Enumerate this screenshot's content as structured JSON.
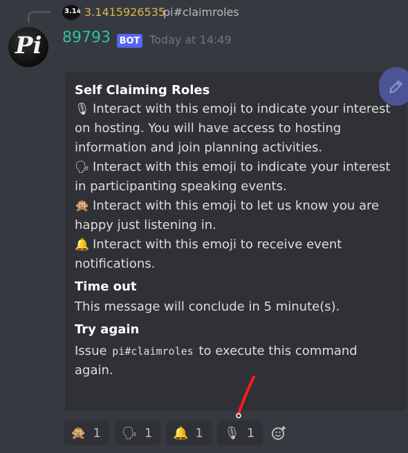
{
  "reply": {
    "avatar_text": "3.14",
    "author": "3.1415926535",
    "preview": "pi#claimroles"
  },
  "message": {
    "avatar_text": "Pi",
    "author": "89793",
    "badge": "BOT",
    "timestamp": "Today at 14:49"
  },
  "embed": {
    "title": "Self Claiming Roles",
    "lines": [
      {
        "emoji": "🎙",
        "text": "Interact with this emoji to indicate your interest on hosting.  You will have access to hosting information and join planning activities."
      },
      {
        "emoji": "🗣",
        "text": "Interact with this emoji to indicate your interest in participanting speaking events."
      },
      {
        "emoji": "🙊",
        "text": "Interact with this emoji to let us know you are happy just listening in."
      },
      {
        "emoji": "🔔",
        "text": "Interact with this emoji to receive event notifications."
      }
    ],
    "timeout_title": "Time out",
    "timeout_text": "This message will conclude in 5 minute(s).",
    "retry_title": "Try again",
    "retry_prefix": "Issue",
    "retry_command": "pi#claimroles",
    "retry_suffix": "to execute this command again."
  },
  "reactions": [
    {
      "emoji": "🙊",
      "count": "1"
    },
    {
      "emoji": "🗣",
      "count": "1"
    },
    {
      "emoji": "🔔",
      "count": "1"
    },
    {
      "emoji": "🎙",
      "count": "1"
    }
  ],
  "add_reaction_icon": "add-reaction-icon",
  "edit_icon": "pencil-icon",
  "colors": {
    "background": "#36393f",
    "embed": "#2f3136",
    "username": "#2ac39e",
    "reply_author": "#d9b84a",
    "bot_badge": "#5865f2",
    "annotation": "#ff0000"
  }
}
